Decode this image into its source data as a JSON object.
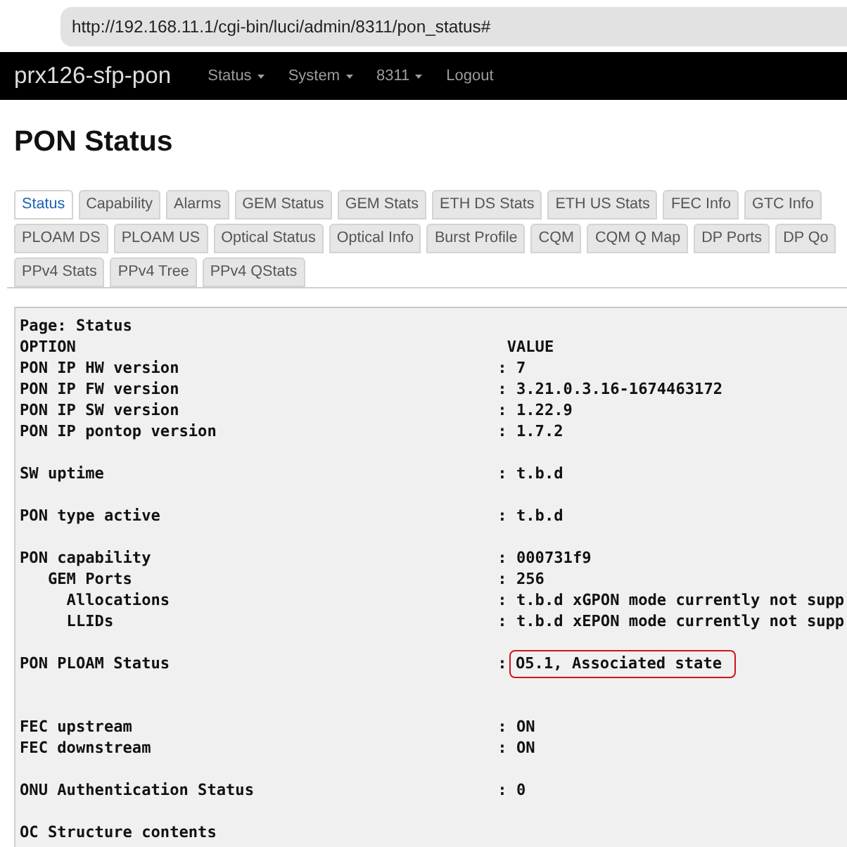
{
  "address_bar": {
    "url": "http://192.168.11.1/cgi-bin/luci/admin/8311/pon_status#"
  },
  "navbar": {
    "brand": "prx126-sfp-pon",
    "menu": [
      {
        "label": "Status",
        "dropdown": true
      },
      {
        "label": "System",
        "dropdown": true
      },
      {
        "label": "8311",
        "dropdown": true
      },
      {
        "label": "Logout",
        "dropdown": false
      }
    ]
  },
  "page_title": "PON Status",
  "tab_rows": [
    {
      "tabs": [
        {
          "label": "Status",
          "selected": true
        },
        {
          "label": "Capability",
          "selected": false
        },
        {
          "label": "Alarms",
          "selected": false
        },
        {
          "label": "GEM Status",
          "selected": false
        },
        {
          "label": "GEM Stats",
          "selected": false
        },
        {
          "label": "ETH DS Stats",
          "selected": false
        },
        {
          "label": "ETH US Stats",
          "selected": false
        },
        {
          "label": "FEC Info",
          "selected": false
        },
        {
          "label": "GTC Info",
          "selected": false
        }
      ]
    },
    {
      "tabs": [
        {
          "label": "PLOAM DS",
          "selected": false
        },
        {
          "label": "PLOAM US",
          "selected": false
        },
        {
          "label": "Optical Status",
          "selected": false
        },
        {
          "label": "Optical Info",
          "selected": false
        },
        {
          "label": "Burst Profile",
          "selected": false
        },
        {
          "label": "CQM",
          "selected": false
        },
        {
          "label": "CQM Q Map",
          "selected": false
        },
        {
          "label": "DP Ports",
          "selected": false
        },
        {
          "label": "DP Qo",
          "selected": false
        }
      ]
    },
    {
      "tabs": [
        {
          "label": "PPv4 Stats",
          "selected": false
        },
        {
          "label": "PPv4 Tree",
          "selected": false
        },
        {
          "label": "PPv4 QStats",
          "selected": false
        }
      ]
    }
  ],
  "output": {
    "page_line": "Page: Status",
    "header": {
      "option": "OPTION",
      "value": "VALUE"
    },
    "groups": [
      {
        "rows": [
          {
            "option": "PON IP HW version",
            "separator": ":",
            "value": "7",
            "highlighted": false
          },
          {
            "option": "PON IP FW version",
            "separator": ":",
            "value": "3.21.0.3.16-1674463172",
            "highlighted": false
          },
          {
            "option": "PON IP SW version",
            "separator": ":",
            "value": "1.22.9",
            "highlighted": false
          },
          {
            "option": "PON IP pontop version",
            "separator": ":",
            "value": "1.7.2",
            "highlighted": false
          }
        ]
      },
      {
        "rows": [
          {
            "option": "SW uptime",
            "separator": ":",
            "value": "t.b.d",
            "highlighted": false
          }
        ]
      },
      {
        "rows": [
          {
            "option": "PON type active",
            "separator": ":",
            "value": "t.b.d",
            "highlighted": false
          }
        ]
      },
      {
        "rows": [
          {
            "option": "PON capability",
            "separator": ":",
            "value": "000731f9",
            "highlighted": false,
            "children": [
              {
                "option": "GEM Ports",
                "separator": ":",
                "value": "256",
                "highlighted": false,
                "children": [
                  {
                    "option": "Allocations",
                    "separator": ":",
                    "value": "t.b.d xGPON mode currently not supp",
                    "highlighted": false
                  },
                  {
                    "option": "LLIDs",
                    "separator": ":",
                    "value": "t.b.d xEPON mode currently not supp",
                    "highlighted": false
                  }
                ]
              }
            ]
          }
        ]
      },
      {
        "rows": [
          {
            "option": "PON PLOAM Status",
            "separator": ":",
            "value": "O5.1, Associated state",
            "highlighted": true
          }
        ]
      },
      {
        "rows": [
          {
            "option": "FEC upstream",
            "separator": ":",
            "value": "ON",
            "highlighted": false
          },
          {
            "option": "FEC downstream",
            "separator": ":",
            "value": "ON",
            "highlighted": false
          }
        ]
      },
      {
        "rows": [
          {
            "option": "ONU Authentication Status",
            "separator": ":",
            "value": "0",
            "highlighted": false
          }
        ]
      },
      {
        "rows": [
          {
            "option": "OC Structure contents",
            "highlighted": false
          }
        ]
      }
    ]
  }
}
